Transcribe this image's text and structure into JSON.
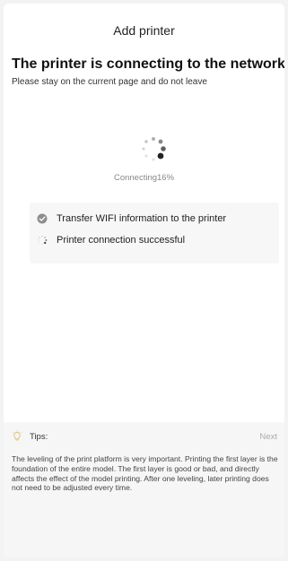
{
  "header": {
    "title": "Add printer"
  },
  "main": {
    "headline": "The printer is connecting to the network",
    "subline": "Please stay on the current page and do not leave",
    "progress": {
      "label": "Connecting",
      "percent_text": "16%",
      "value_percent": 16
    },
    "steps": [
      {
        "label": "Transfer WIFI information to the printer",
        "status": "completed",
        "icon": "check-circle-icon"
      },
      {
        "label": "Printer connection successful",
        "status": "in-progress",
        "icon": "spinner-icon"
      }
    ]
  },
  "tips": {
    "title": "Tips:",
    "next_label": "Next",
    "icon": "lightbulb-icon",
    "body": "The leveling of the print platform is very important. Printing the first layer is the foundation of the entire model. The first layer is good or bad, and directly affects the effect of the model printing. After one leveling, later printing does not need to be adjusted every time."
  },
  "colors": {
    "background": "#ffffff",
    "page_bg": "#f3f3f3",
    "card_bg": "#f7f7f7",
    "muted_text": "#888888",
    "next_link": "#aaaaaa"
  }
}
